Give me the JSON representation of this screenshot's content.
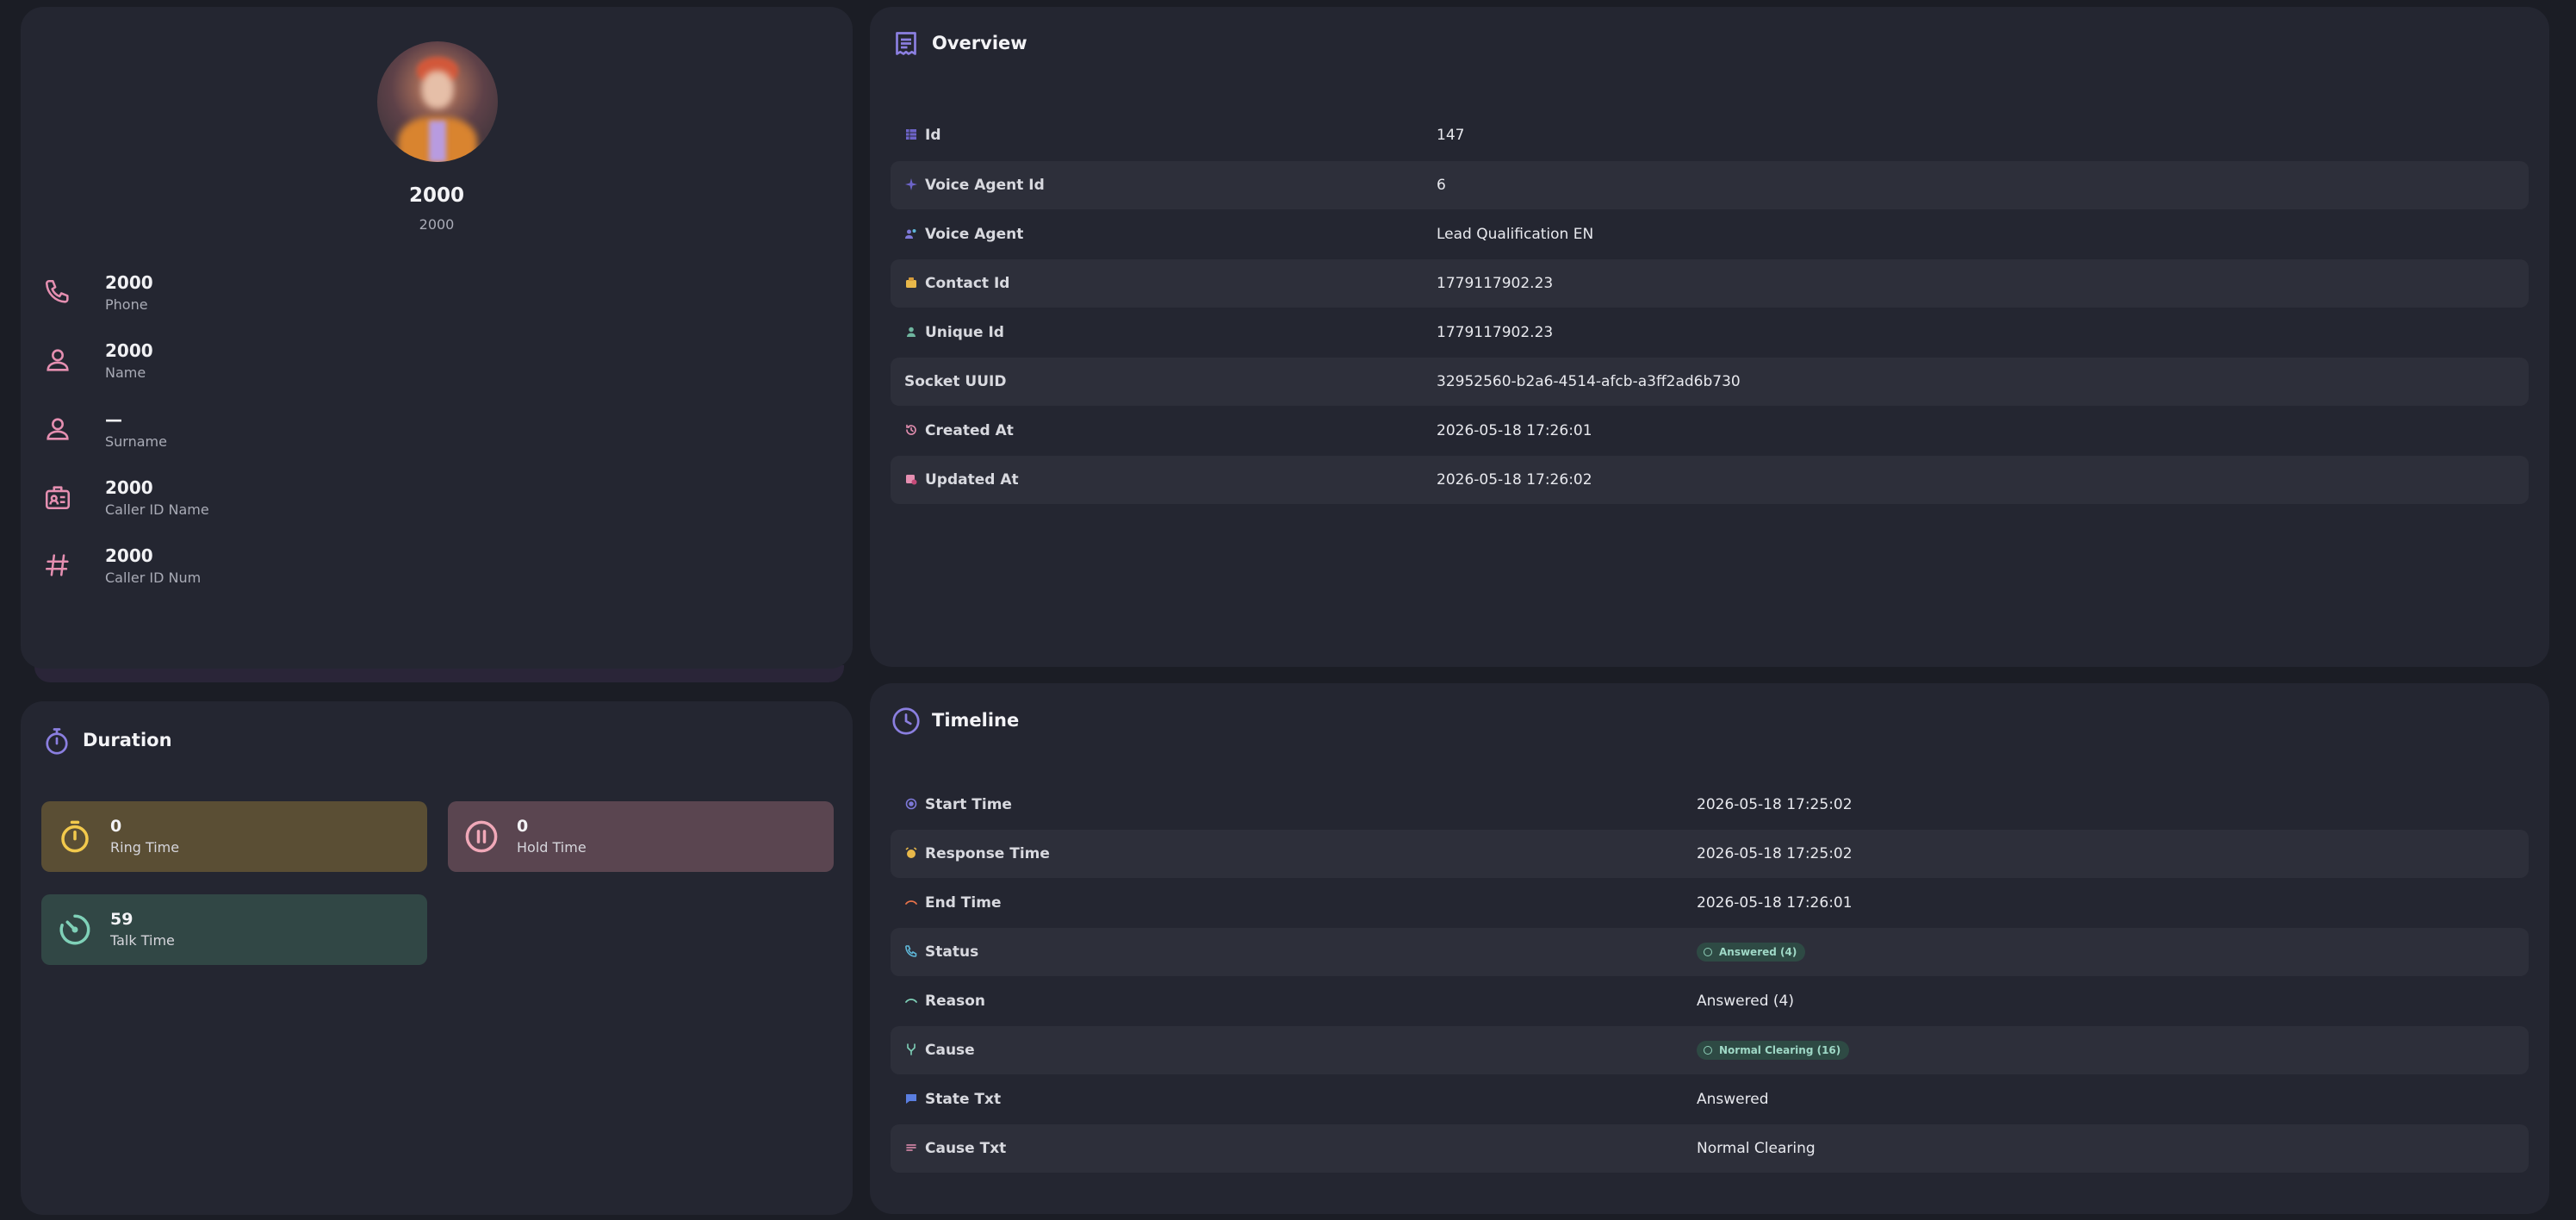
{
  "profile": {
    "name": "2000",
    "subtitle": "2000",
    "fields": [
      {
        "icon": "phone-icon",
        "value": "2000",
        "label": "Phone"
      },
      {
        "icon": "person-icon",
        "value": "2000",
        "label": "Name"
      },
      {
        "icon": "person-icon",
        "value": "—",
        "label": "Surname"
      },
      {
        "icon": "id-card-icon",
        "value": "2000",
        "label": "Caller ID Name"
      },
      {
        "icon": "hash-icon",
        "value": "2000",
        "label": "Caller ID Num"
      }
    ]
  },
  "duration": {
    "title": "Duration",
    "items": [
      {
        "label": "Ring Time",
        "value": "0",
        "color": "#5a4e34",
        "icon": "stopwatch-icon"
      },
      {
        "label": "Hold Time",
        "value": "0",
        "color": "#5a4550",
        "icon": "pause-icon"
      },
      {
        "label": "Talk Time",
        "value": "59",
        "color": "#314745",
        "icon": "timer-icon"
      }
    ]
  },
  "overview": {
    "title": "Overview",
    "rows": [
      {
        "key": "Id",
        "value": "147"
      },
      {
        "key": "Voice Agent Id",
        "value": "6"
      },
      {
        "key": "Voice Agent",
        "value": "Lead Qualification EN"
      },
      {
        "key": "Contact Id",
        "value": "1779117902.23"
      },
      {
        "key": "Unique Id",
        "value": "1779117902.23"
      },
      {
        "key": "Socket UUID",
        "value": "32952560-b2a6-4514-afcb-a3ff2ad6b730"
      },
      {
        "key": "Created At",
        "value": "2026-05-18 17:26:01"
      },
      {
        "key": "Updated At",
        "value": "2026-05-18 17:26:02"
      }
    ]
  },
  "timeline": {
    "title": "Timeline",
    "rows": [
      {
        "key": "Start Time",
        "value": "2026-05-18 17:25:02"
      },
      {
        "key": "Response Time",
        "value": "2026-05-18 17:25:02"
      },
      {
        "key": "End Time",
        "value": "2026-05-18 17:26:01"
      },
      {
        "key": "Status",
        "value": "Answered (4)",
        "badge": true
      },
      {
        "key": "Reason",
        "value": "Answered (4)"
      },
      {
        "key": "Cause",
        "value": "Normal Clearing (16)",
        "badge": true
      },
      {
        "key": "State Txt",
        "value": "Answered"
      },
      {
        "key": "Cause Txt",
        "value": "Normal Clearing"
      }
    ]
  },
  "colors": {
    "accent": "#6e63c9",
    "pink_icon": "#e58fb1",
    "badge_bg": "#2e4a44",
    "badge_text": "#9fd8c6"
  }
}
